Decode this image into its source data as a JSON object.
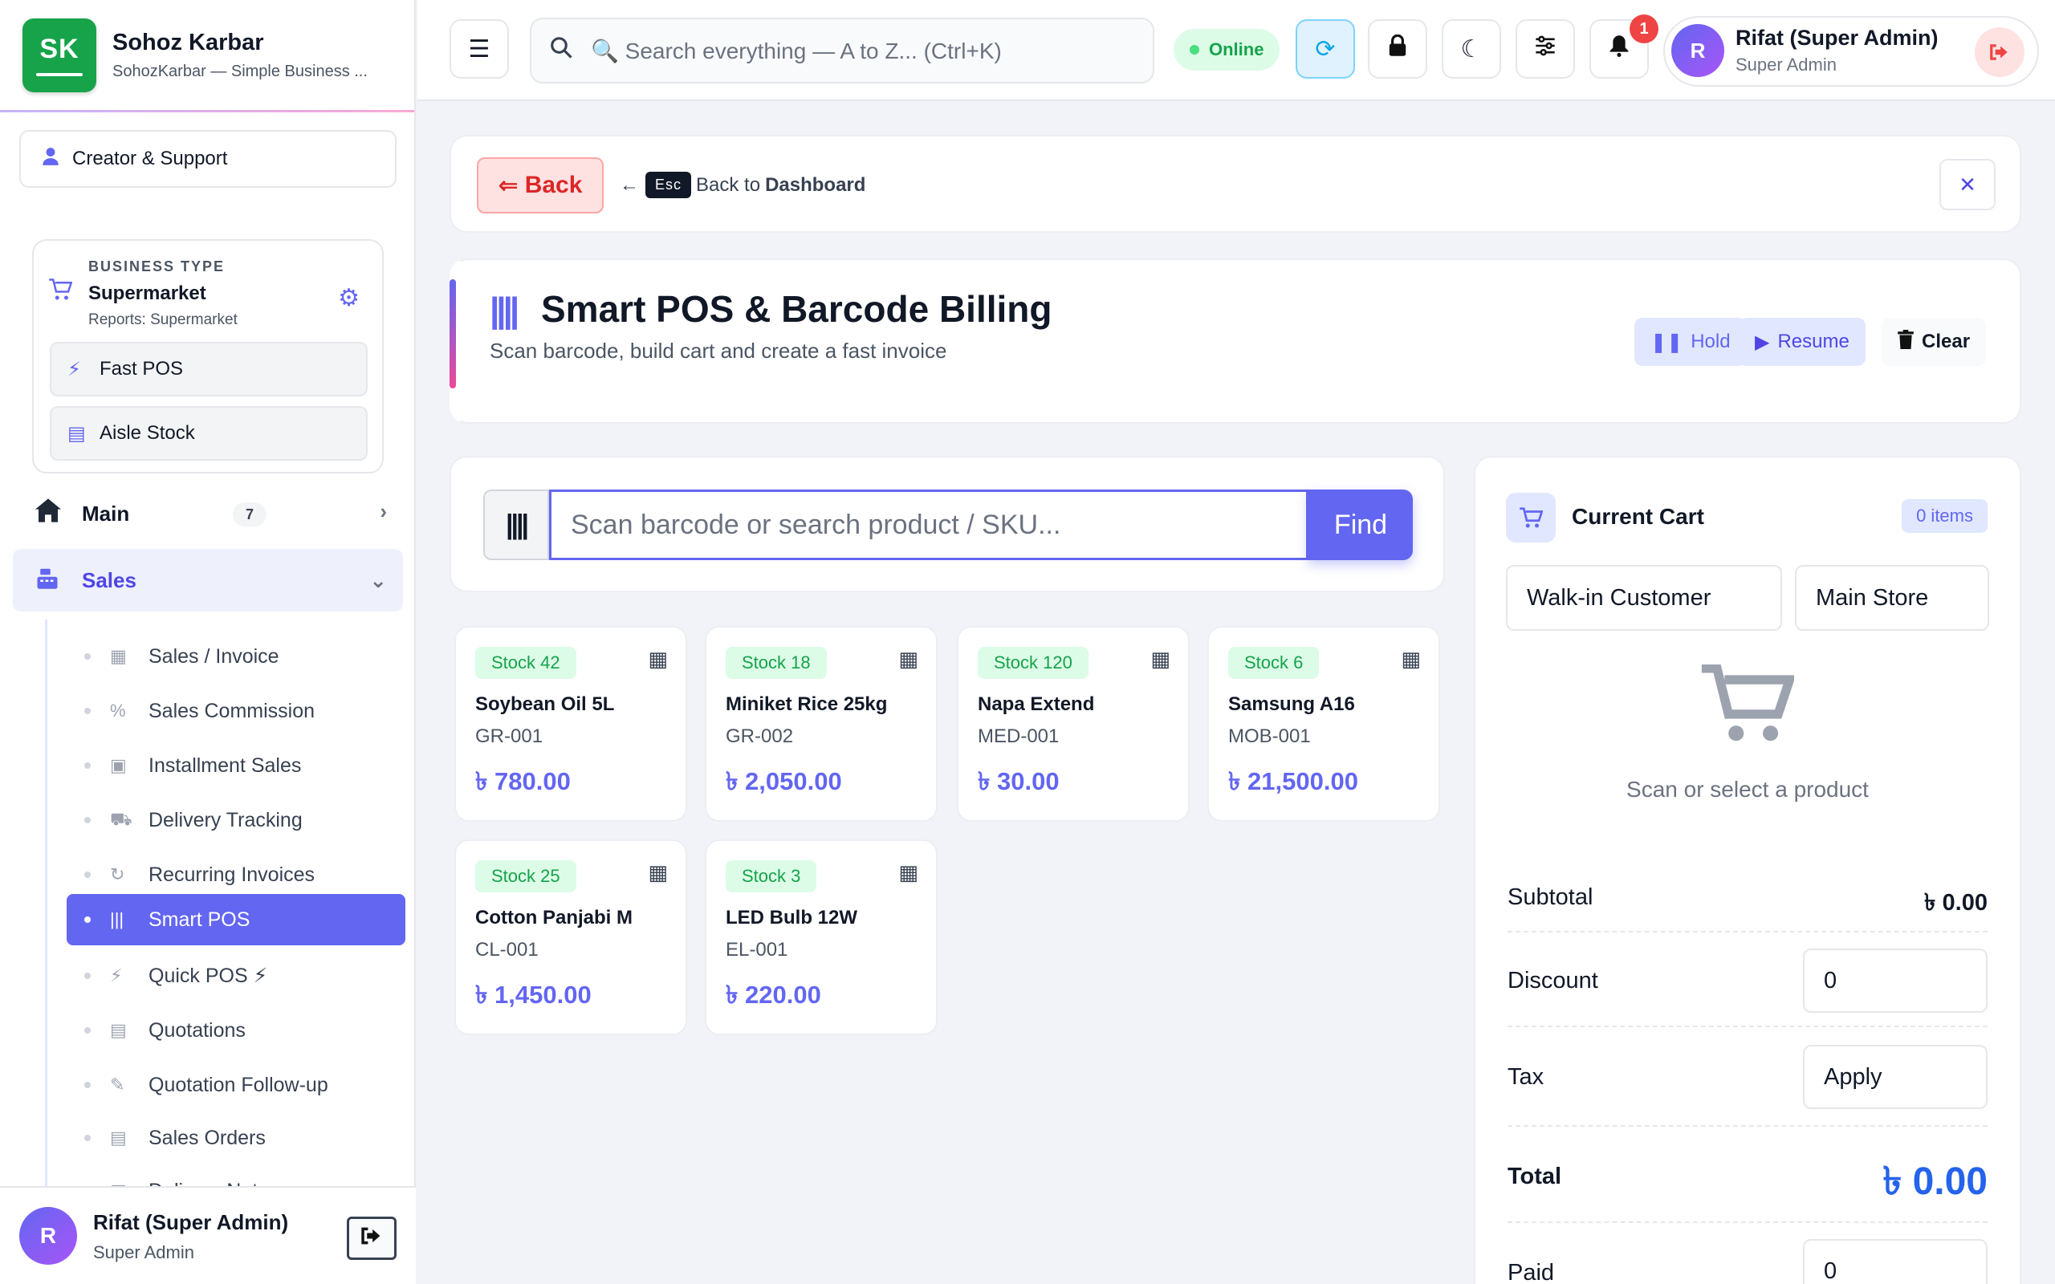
{
  "brand": {
    "logo_text": "SK",
    "name": "Sohoz Karbar",
    "subtitle": "SohozKarbar — Simple Business ..."
  },
  "sidebar": {
    "creator_label": "Creator & Support",
    "business": {
      "label": "BUSINESS TYPE",
      "type": "Supermarket",
      "reports": "Reports: Supermarket",
      "buttons": [
        "Fast POS",
        "Aisle Stock"
      ]
    },
    "main": {
      "label": "Main",
      "count": "7"
    },
    "sales": {
      "label": "Sales"
    },
    "sub_items": [
      "Sales / Invoice",
      "Sales Commission",
      "Installment Sales",
      "Delivery Tracking",
      "Recurring Invoices",
      "Smart POS",
      "Quick POS ⚡",
      "Quotations",
      "Quotation Follow-up",
      "Sales Orders",
      "Delivery Notes"
    ],
    "user": {
      "initial": "R",
      "name": "Rifat (Super Admin)",
      "role": "Super Admin"
    }
  },
  "topbar": {
    "search_placeholder": "🔍 Search everything — A to Z... (Ctrl+K)",
    "status": "Online",
    "notification_count": "1",
    "profile": {
      "initial": "R",
      "name": "Rifat (Super Admin)",
      "role": "Super Admin"
    }
  },
  "back_bar": {
    "back_label": "Back",
    "arrow": "←",
    "key": "Esc",
    "hint_prefix": "Back to",
    "hint_target": "Dashboard"
  },
  "page": {
    "title": "Smart POS & Barcode Billing",
    "subtitle": "Scan barcode, build cart and create a fast invoice",
    "actions": {
      "hold": "Hold",
      "resume": "Resume",
      "clear": "Clear"
    }
  },
  "scanner": {
    "placeholder": "Scan barcode or search product / SKU...",
    "find_label": "Find"
  },
  "products": [
    {
      "stock": "Stock 42",
      "name": "Soybean Oil 5L",
      "sku": "GR-001",
      "price": "৳ 780.00"
    },
    {
      "stock": "Stock 18",
      "name": "Miniket Rice 25kg",
      "sku": "GR-002",
      "price": "৳ 2,050.00"
    },
    {
      "stock": "Stock 120",
      "name": "Napa Extend",
      "sku": "MED-001",
      "price": "৳ 30.00"
    },
    {
      "stock": "Stock 6",
      "name": "Samsung A16",
      "sku": "MOB-001",
      "price": "৳ 21,500.00"
    },
    {
      "stock": "Stock 25",
      "name": "Cotton Panjabi M",
      "sku": "CL-001",
      "price": "৳ 1,450.00"
    },
    {
      "stock": "Stock 3",
      "name": "LED Bulb 12W",
      "sku": "EL-001",
      "price": "৳ 220.00"
    }
  ],
  "cart": {
    "title": "Current Cart",
    "items_badge": "0 items",
    "customer": "Walk-in Customer",
    "store": "Main Store",
    "empty_text": "Scan or select a product",
    "subtotal_label": "Subtotal",
    "subtotal_value": "৳ 0.00",
    "discount_label": "Discount",
    "discount_value": "0",
    "tax_label": "Tax",
    "tax_value": "Apply",
    "total_label": "Total",
    "total_value": "৳ 0.00",
    "paid_label": "Paid",
    "paid_value": "0"
  },
  "colors": {
    "accent": "#6366f1",
    "brand_green": "#16a34a",
    "danger": "#dc2626",
    "total_blue": "#2563eb"
  }
}
